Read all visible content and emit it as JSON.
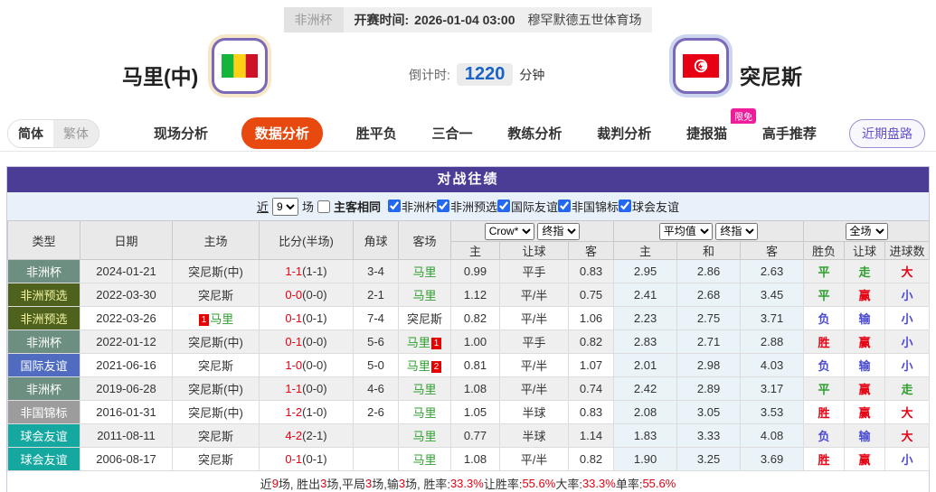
{
  "top_bar": {
    "league": "非洲杯",
    "kickoff_label": "开赛时间:",
    "kickoff_time": "2026-01-04 03:00",
    "venue": "穆罕默德五世体育场"
  },
  "team_header": {
    "home_name": "马里(中)",
    "countdown_label": "倒计时:",
    "countdown_value": "1220",
    "countdown_unit": "分钟",
    "away_name": "突尼斯"
  },
  "nav": {
    "lang": [
      {
        "label": "简体",
        "active": true
      },
      {
        "label": "繁体",
        "active": false
      }
    ],
    "items": [
      {
        "label": "现场分析",
        "active": false
      },
      {
        "label": "数据分析",
        "active": true
      },
      {
        "label": "胜平负",
        "active": false
      },
      {
        "label": "三合一",
        "active": false
      },
      {
        "label": "教练分析",
        "active": false
      },
      {
        "label": "裁判分析",
        "active": false
      },
      {
        "label": "捷报猫",
        "active": false,
        "badge": "限免"
      },
      {
        "label": "高手推荐",
        "active": false
      }
    ],
    "recent_trend_button": "近期盘路"
  },
  "h2h": {
    "title": "对战往绩",
    "filter": {
      "recent_label": "近",
      "recent_count": "9",
      "unit": "场",
      "same_home_away": "主客相同",
      "competitions": [
        "非洲杯",
        "非洲预选",
        "国际友谊",
        "非国锦标",
        "球会友谊"
      ]
    },
    "selects": {
      "bookmaker": "Crow*",
      "ah_stage": "终指",
      "eu_source": "平均值",
      "eu_stage": "终指",
      "scope": "全场"
    },
    "columns": {
      "type": "类型",
      "date": "日期",
      "home": "主场",
      "score": "比分(半场)",
      "corner": "角球",
      "away": "客场",
      "ah_home": "主",
      "ah_line": "让球",
      "ah_away": "客",
      "eu_home": "主",
      "eu_draw": "和",
      "eu_away": "客",
      "result_wdl": "胜负",
      "result_ah": "让球",
      "result_goals": "进球数"
    },
    "type_colors": {
      "非洲杯": {
        "bg": "#6d8f81",
        "fg": "#ffffff"
      },
      "非洲预选": {
        "bg": "#4e621e",
        "fg": "#f2f2a0"
      },
      "国际友谊": {
        "bg": "#4f6cc0",
        "fg": "#ffffff"
      },
      "非国锦标": {
        "bg": "#9c9c9c",
        "fg": "#ffffff"
      },
      "球会友谊": {
        "bg": "#14a8a0",
        "fg": "#ffffff"
      }
    },
    "rows": [
      {
        "type": "非洲杯",
        "date": "2024-01-21",
        "home": "突尼斯(中)",
        "home_is_mali": false,
        "home_card": null,
        "score": "1-1",
        "half": "(1-1)",
        "corner": "3-4",
        "away": "马里",
        "away_is_mali": true,
        "away_card": null,
        "ah": [
          "0.99",
          "平手",
          "0.83"
        ],
        "eu": [
          "2.95",
          "2.86",
          "2.63"
        ],
        "res": [
          [
            "平",
            "g"
          ],
          [
            "走",
            "g"
          ],
          [
            "大",
            "r"
          ]
        ],
        "shade": true
      },
      {
        "type": "非洲预选",
        "date": "2022-03-30",
        "home": "突尼斯",
        "home_is_mali": false,
        "home_card": null,
        "score": "0-0",
        "half": "(0-0)",
        "corner": "2-1",
        "away": "马里",
        "away_is_mali": true,
        "away_card": null,
        "ah": [
          "1.12",
          "平/半",
          "0.75"
        ],
        "eu": [
          "2.41",
          "2.68",
          "3.45"
        ],
        "res": [
          [
            "平",
            "g"
          ],
          [
            "赢",
            "r"
          ],
          [
            "小",
            "b"
          ]
        ],
        "shade": true
      },
      {
        "type": "非洲预选",
        "date": "2022-03-26",
        "home": "马里",
        "home_is_mali": true,
        "home_card": "1",
        "score": "0-1",
        "half": "(0-1)",
        "corner": "7-4",
        "away": "突尼斯",
        "away_is_mali": false,
        "away_card": null,
        "ah": [
          "0.82",
          "平/半",
          "1.06"
        ],
        "eu": [
          "2.23",
          "2.75",
          "3.71"
        ],
        "res": [
          [
            "负",
            "b"
          ],
          [
            "输",
            "b"
          ],
          [
            "小",
            "b"
          ]
        ],
        "shade": false
      },
      {
        "type": "非洲杯",
        "date": "2022-01-12",
        "home": "突尼斯(中)",
        "home_is_mali": false,
        "home_card": null,
        "score": "0-1",
        "half": "(0-0)",
        "corner": "5-6",
        "away": "马里",
        "away_is_mali": true,
        "away_card": "1",
        "ah": [
          "1.00",
          "平手",
          "0.82"
        ],
        "eu": [
          "2.83",
          "2.71",
          "2.88"
        ],
        "res": [
          [
            "胜",
            "r"
          ],
          [
            "赢",
            "r"
          ],
          [
            "小",
            "b"
          ]
        ],
        "shade": true
      },
      {
        "type": "国际友谊",
        "date": "2021-06-16",
        "home": "突尼斯",
        "home_is_mali": false,
        "home_card": null,
        "score": "1-0",
        "half": "(0-0)",
        "corner": "5-0",
        "away": "马里",
        "away_is_mali": true,
        "away_card": "2",
        "ah": [
          "0.81",
          "平/半",
          "1.07"
        ],
        "eu": [
          "2.01",
          "2.98",
          "4.03"
        ],
        "res": [
          [
            "负",
            "b"
          ],
          [
            "输",
            "b"
          ],
          [
            "小",
            "b"
          ]
        ],
        "shade": false
      },
      {
        "type": "非洲杯",
        "date": "2019-06-28",
        "home": "突尼斯(中)",
        "home_is_mali": false,
        "home_card": null,
        "score": "1-1",
        "half": "(0-0)",
        "corner": "4-6",
        "away": "马里",
        "away_is_mali": true,
        "away_card": null,
        "ah": [
          "1.08",
          "平/半",
          "0.74"
        ],
        "eu": [
          "2.42",
          "2.89",
          "3.17"
        ],
        "res": [
          [
            "平",
            "g"
          ],
          [
            "赢",
            "r"
          ],
          [
            "走",
            "g"
          ]
        ],
        "shade": true
      },
      {
        "type": "非国锦标",
        "date": "2016-01-31",
        "home": "突尼斯(中)",
        "home_is_mali": false,
        "home_card": null,
        "score": "1-2",
        "half": "(1-0)",
        "corner": "2-6",
        "away": "马里",
        "away_is_mali": true,
        "away_card": null,
        "ah": [
          "1.05",
          "半球",
          "0.83"
        ],
        "eu": [
          "2.08",
          "3.05",
          "3.53"
        ],
        "res": [
          [
            "胜",
            "r"
          ],
          [
            "赢",
            "r"
          ],
          [
            "大",
            "r"
          ]
        ],
        "shade": false
      },
      {
        "type": "球会友谊",
        "date": "2011-08-11",
        "home": "突尼斯",
        "home_is_mali": false,
        "home_card": null,
        "score": "4-2",
        "half": "(2-1)",
        "corner": "",
        "away": "马里",
        "away_is_mali": true,
        "away_card": null,
        "ah": [
          "0.77",
          "半球",
          "1.14"
        ],
        "eu": [
          "1.83",
          "3.33",
          "4.08"
        ],
        "res": [
          [
            "负",
            "b"
          ],
          [
            "输",
            "b"
          ],
          [
            "大",
            "r"
          ]
        ],
        "shade": true
      },
      {
        "type": "球会友谊",
        "date": "2006-08-17",
        "home": "突尼斯",
        "home_is_mali": false,
        "home_card": null,
        "score": "0-1",
        "half": "(0-1)",
        "corner": "",
        "away": "马里",
        "away_is_mali": true,
        "away_card": null,
        "ah": [
          "1.08",
          "平/半",
          "0.82"
        ],
        "eu": [
          "1.90",
          "3.25",
          "3.69"
        ],
        "res": [
          [
            "胜",
            "r"
          ],
          [
            "赢",
            "r"
          ],
          [
            "小",
            "b"
          ]
        ],
        "shade": false
      }
    ],
    "summary_parts": [
      [
        "近 ",
        "d"
      ],
      [
        "9",
        "r"
      ],
      [
        " 场, 胜出 ",
        "d"
      ],
      [
        "3",
        "r"
      ],
      [
        " 场,平局 ",
        "d"
      ],
      [
        "3",
        "r"
      ],
      [
        " 场,输 ",
        "d"
      ],
      [
        "3",
        "r"
      ],
      [
        " 场, 胜率: ",
        "d"
      ],
      [
        "33.3%",
        "r"
      ],
      [
        " 让胜率: ",
        "d"
      ],
      [
        "55.6%",
        "r"
      ],
      [
        " 大率: ",
        "d"
      ],
      [
        "33.3%",
        "r"
      ],
      [
        " 单率: ",
        "d"
      ],
      [
        "55.6%",
        "r"
      ]
    ]
  },
  "colors": {
    "accent_purple": "#4b3c96",
    "accent_orange": "#e8490f",
    "win_red": "#e60012",
    "draw_green": "#2f9e2f",
    "lose_blue": "#4a4ad2"
  }
}
